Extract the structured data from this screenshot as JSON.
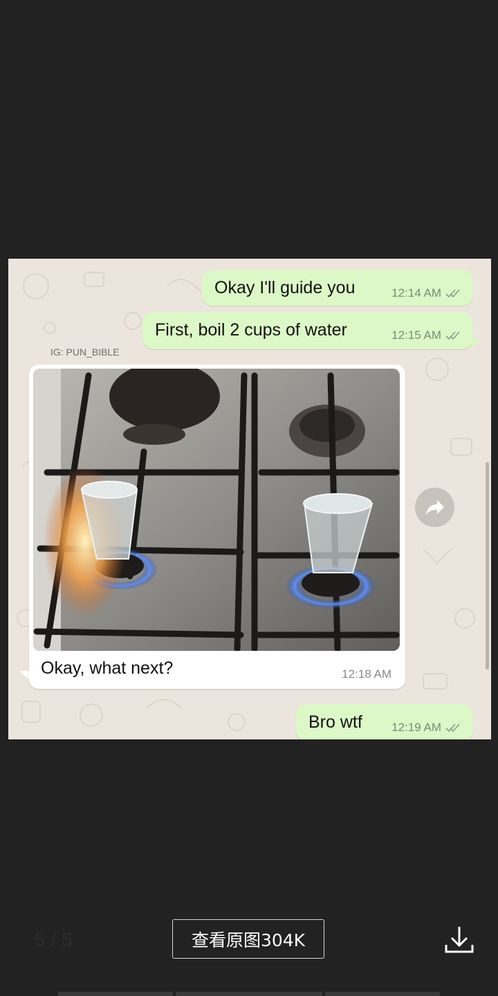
{
  "viewer": {
    "counter": "5 / 5",
    "view_original_label": "查看原图304K",
    "download_icon": "download-icon"
  },
  "chat": {
    "watermark": "IG: PUN_BIBLE",
    "messages": [
      {
        "direction": "outgoing",
        "text": "Okay I'll guide you",
        "time": "12:14 AM",
        "status": "read"
      },
      {
        "direction": "outgoing",
        "text": "First, boil 2 cups of water",
        "time": "12:15 AM",
        "status": "read"
      },
      {
        "direction": "incoming",
        "type": "image",
        "caption": "Okay, what next?",
        "time": "12:18 AM"
      },
      {
        "direction": "outgoing",
        "text": "Bro wtf",
        "time": "12:19 AM",
        "status": "read"
      }
    ],
    "forward_icon": "forward-icon"
  },
  "colors": {
    "background": "#222222",
    "chat_background": "#ece5dd",
    "outgoing_bubble": "#dcf8c6",
    "incoming_bubble": "#ffffff"
  }
}
